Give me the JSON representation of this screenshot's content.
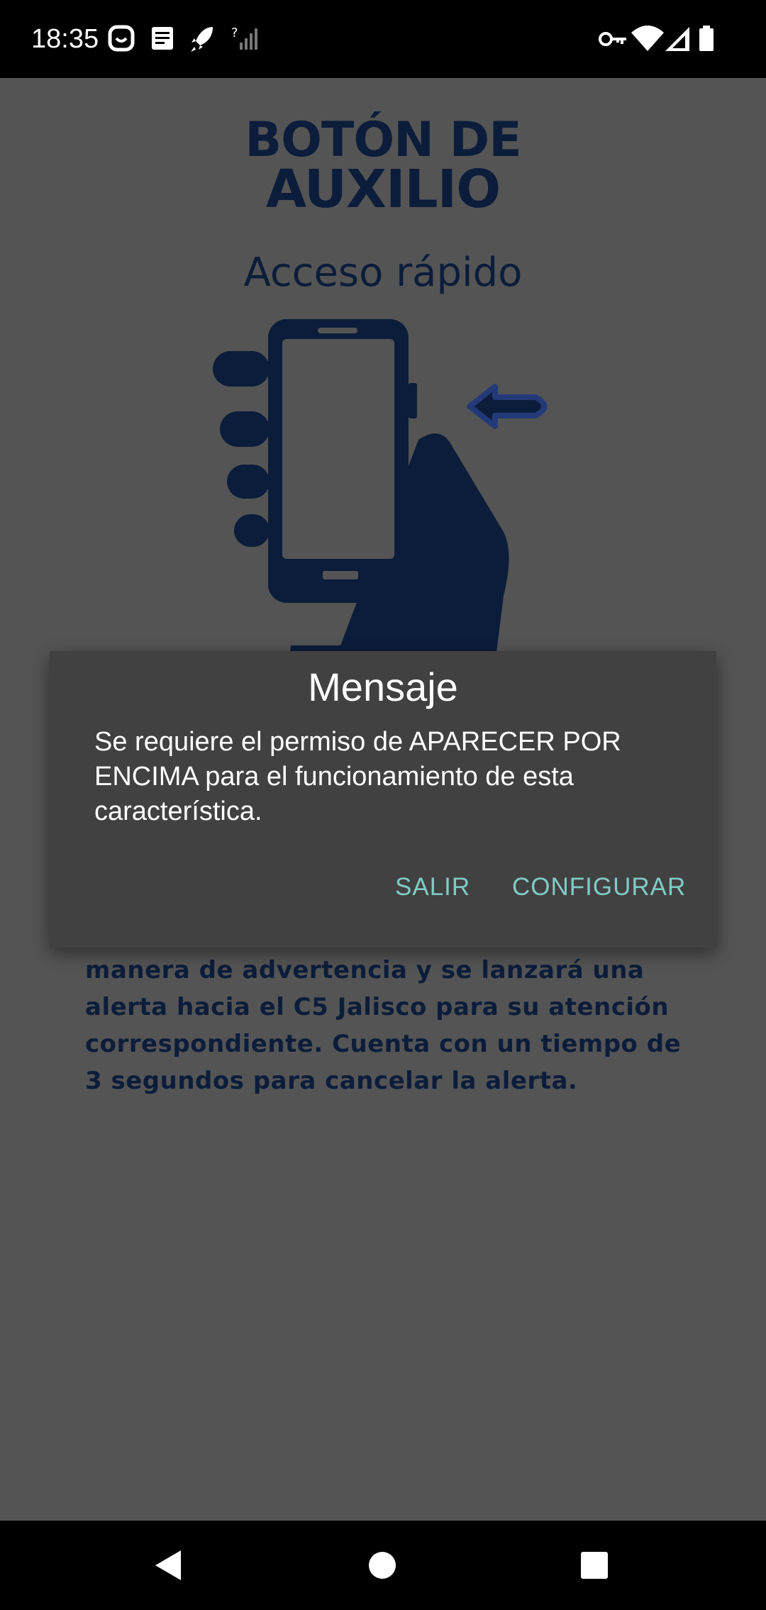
{
  "status_bar": {
    "time": "18:35",
    "left_icons": [
      "notification-face-icon",
      "document-icon",
      "rocket-icon",
      "signal-unknown-icon"
    ],
    "right_icons": [
      "vpn-key-icon",
      "wifi-icon",
      "cell-signal-icon",
      "battery-icon"
    ]
  },
  "app": {
    "title_line1": "BOTÓN DE",
    "title_line2": "AUXILIO",
    "subtitle": "Acceso rápido",
    "illustration": "hand-holding-phone-icon",
    "description_lines": [
      "manera de advertencia y se lanzará una",
      "alerta hacia el C5 Jalisco para su atención",
      "correspondiente. Cuenta con un tiempo de",
      "3 segundos para cancelar la alerta."
    ],
    "text_color": "#0c1d3b"
  },
  "dialog": {
    "title": "Mensaje",
    "message": "Se requiere el permiso de APARECER POR ENCIMA para el funcionamiento de esta característica.",
    "negative_button": "SALIR",
    "positive_button": "CONFIGURAR",
    "button_color": "#80cbc4",
    "background_color": "#414141"
  },
  "nav_bar": {
    "icons": [
      "back-icon",
      "home-icon",
      "recents-icon"
    ]
  }
}
